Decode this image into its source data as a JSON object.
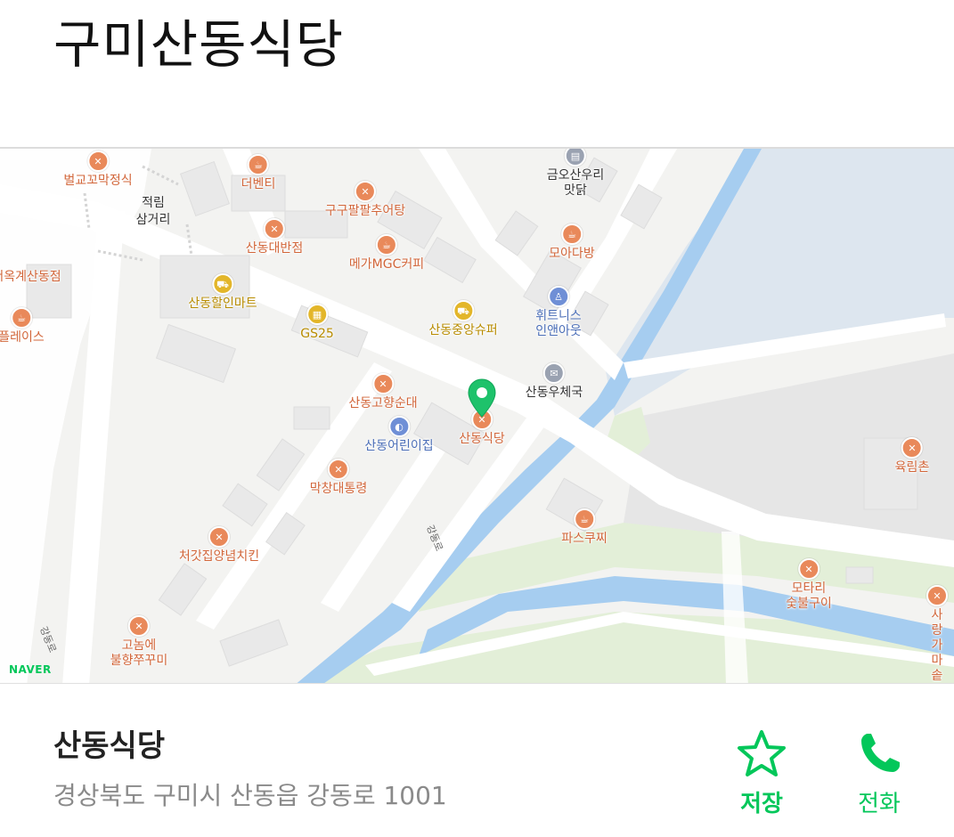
{
  "header": {
    "title": "구미산동식당"
  },
  "map": {
    "logo": "NAVER",
    "road_label": "강동로",
    "road_label_2": "강동로",
    "area_labels": [
      {
        "id": "jeongrim",
        "text": "적림\n삼거리"
      }
    ],
    "pois": [
      {
        "id": "beolgyo",
        "text": "벌교꼬막정식",
        "icon": "restaurant-icon",
        "kind": "orange"
      },
      {
        "id": "debenti",
        "text": "더벤티",
        "icon": "cafe-icon",
        "kind": "orange"
      },
      {
        "id": "geumosan",
        "text": "금오산우리\n맛닭",
        "icon": "building-icon",
        "kind": "gray"
      },
      {
        "id": "gugupal",
        "text": "구구팔팔추어탕",
        "icon": "restaurant-icon",
        "kind": "orange"
      },
      {
        "id": "sandongdaeban",
        "text": "산동대반점",
        "icon": "restaurant-icon",
        "kind": "orange"
      },
      {
        "id": "megamgc",
        "text": "메가MGC커피",
        "icon": "cafe-icon",
        "kind": "orange"
      },
      {
        "id": "moadabang",
        "text": "모아다방",
        "icon": "cafe-icon",
        "kind": "orange"
      },
      {
        "id": "okgye",
        "text": "서옥계산동점",
        "icon": "restaurant-icon",
        "kind": "orange"
      },
      {
        "id": "halin",
        "text": "산동할인마트",
        "icon": "mart-icon",
        "kind": "yellow"
      },
      {
        "id": "gs25",
        "text": "GS25",
        "icon": "store-icon",
        "kind": "yellow"
      },
      {
        "id": "jungang",
        "text": "산동중앙슈퍼",
        "icon": "mart-icon",
        "kind": "yellow"
      },
      {
        "id": "fitness",
        "text": "휘트니스\n인앤아웃",
        "icon": "fitness-icon",
        "kind": "blue"
      },
      {
        "id": "place",
        "text": "플레이스",
        "icon": "cafe-icon",
        "kind": "orange"
      },
      {
        "id": "post",
        "text": "산동우체국",
        "icon": "post-icon",
        "kind": "gray"
      },
      {
        "id": "gohyang",
        "text": "산동고향순대",
        "icon": "restaurant-icon",
        "kind": "orange"
      },
      {
        "id": "sikdang",
        "text": "산동식당",
        "icon": "restaurant-icon",
        "kind": "orange"
      },
      {
        "id": "eorinijip",
        "text": "산동어린이집",
        "icon": "school-icon",
        "kind": "blue"
      },
      {
        "id": "makchang",
        "text": "막창대통령",
        "icon": "restaurant-icon",
        "kind": "orange"
      },
      {
        "id": "yukrim",
        "text": "육림촌",
        "icon": "restaurant-icon",
        "kind": "orange"
      },
      {
        "id": "paskuchi",
        "text": "파스쿠찌",
        "icon": "cafe-icon",
        "kind": "orange"
      },
      {
        "id": "cheogat",
        "text": "처갓집양념치킨",
        "icon": "chicken-icon",
        "kind": "orange"
      },
      {
        "id": "motari",
        "text": "모타리\n숯불구이",
        "icon": "restaurant-icon",
        "kind": "orange"
      },
      {
        "id": "sarang",
        "text": "사랑\n가마솥",
        "icon": "restaurant-icon",
        "kind": "orange"
      },
      {
        "id": "gonome",
        "text": "고놈에\n불향쭈꾸미",
        "icon": "restaurant-icon",
        "kind": "orange"
      }
    ],
    "marker_icon": "location-pin-icon"
  },
  "place": {
    "name": "산동식당",
    "address": "경상북도 구미시 산동읍 강동로 1001"
  },
  "actions": {
    "save_label": "저장",
    "save_icon": "star-icon",
    "call_label": "전화",
    "call_icon": "phone-icon"
  },
  "colors": {
    "accent": "#03c75a",
    "water": "#a6cdf0",
    "poi_food": "#e9895a",
    "poi_mart": "#e3b62a"
  }
}
